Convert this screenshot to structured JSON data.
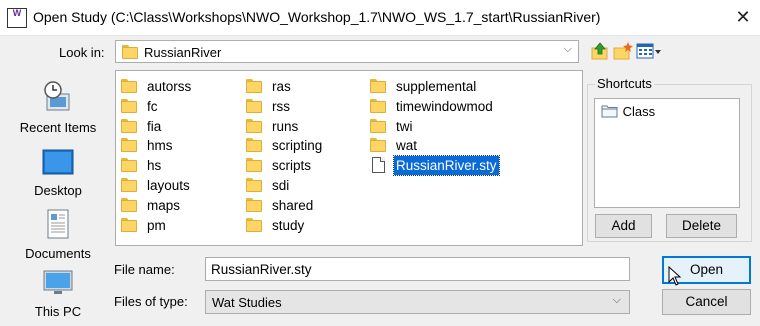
{
  "window": {
    "title": "Open Study  (C:\\Class\\Workshops\\NWO_Workshop_1.7\\NWO_WS_1.7_start\\RussianRiver)",
    "close": "✕",
    "app_icon_text": "W"
  },
  "look_in": {
    "label": "Look in:",
    "value": "RussianRiver",
    "arrow": "⌵"
  },
  "toolbar": {
    "up_icon": "folder-up-icon",
    "new_folder_icon": "new-folder-icon",
    "view_icon": "view-menu-icon"
  },
  "places": [
    {
      "label": "Recent Items",
      "icon": "recent-items-icon"
    },
    {
      "label": "Desktop",
      "icon": "desktop-icon"
    },
    {
      "label": "Documents",
      "icon": "documents-icon"
    },
    {
      "label": "This PC",
      "icon": "this-pc-icon"
    }
  ],
  "files": {
    "col1": [
      "autorss",
      "fc",
      "fia",
      "hms",
      "hs",
      "layouts",
      "maps",
      "pm"
    ],
    "col2": [
      "ras",
      "rss",
      "runs",
      "scripting",
      "scripts",
      "sdi",
      "shared",
      "study"
    ],
    "col3": [
      "supplemental",
      "timewindowmod",
      "twi",
      "wat"
    ],
    "selected_file": "RussianRiver.sty"
  },
  "shortcuts": {
    "title": "Shortcuts",
    "items": [
      "Class"
    ],
    "add_label": "Add",
    "delete_label": "Delete"
  },
  "file_name": {
    "label": "File name:",
    "value": "RussianRiver.sty"
  },
  "file_type": {
    "label": "Files of type:",
    "value": "Wat Studies",
    "arrow": "⌵"
  },
  "buttons": {
    "open": "Open",
    "cancel": "Cancel"
  },
  "colors": {
    "selection": "#0a6ad8",
    "folder": "#fcd565",
    "accent": "#0078d7"
  }
}
